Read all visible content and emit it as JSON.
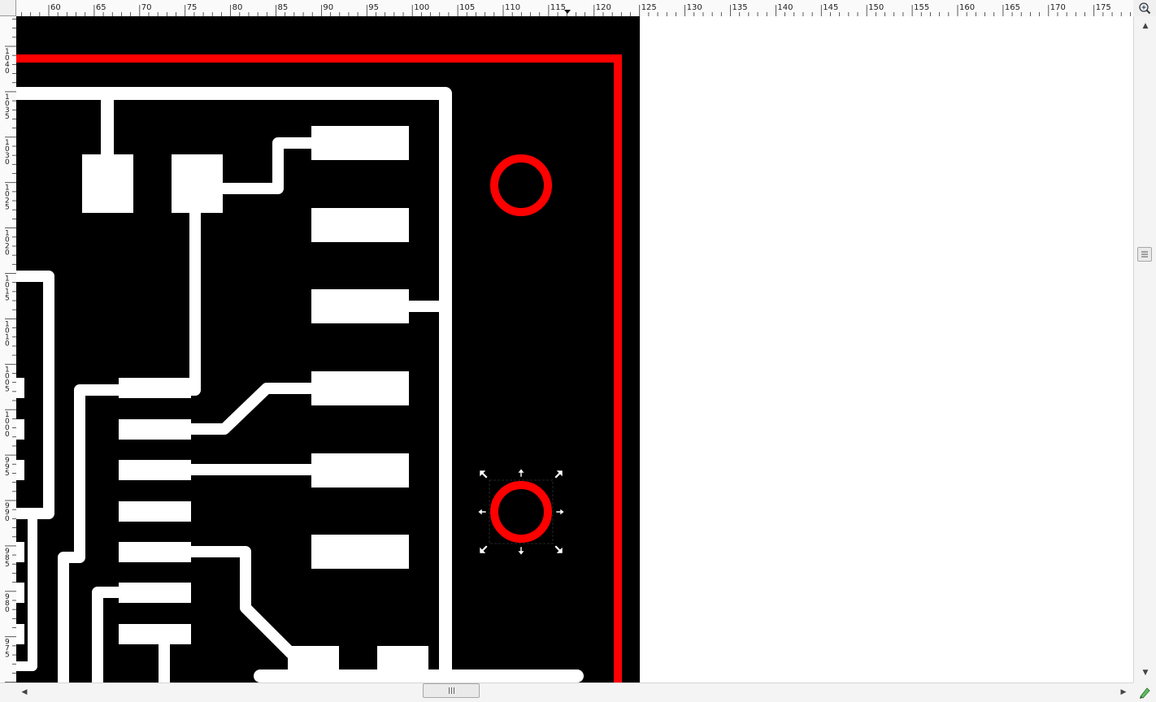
{
  "app": {
    "view": "canvas",
    "zoom_icon": "zoom-fit-icon",
    "status_icon": "pen-pressure-icon"
  },
  "ruler": {
    "horizontal_labels": [
      "60",
      "65",
      "70",
      "75",
      "80",
      "85",
      "90",
      "95",
      "100",
      "105",
      "110",
      "115",
      "120",
      "125",
      "130",
      "135",
      "140",
      "145",
      "150",
      "155",
      "160",
      "165",
      "170",
      "175"
    ],
    "vertical_labels": [
      "1\n0\n4\n0",
      "1\n0\n3\n5",
      "1\n0\n3\n0",
      "1\n0\n2\n5",
      "1\n0\n2\n0",
      "1\n0\n1\n5",
      "1\n0\n1\n0",
      "1\n0\n0\n5",
      "1\n0\n0\n0",
      "9\n9\n5",
      "9\n9\n0",
      "9\n8\n5",
      "9\n8\n0",
      "9\n7\n5"
    ]
  },
  "colors": {
    "board": "#000000",
    "trace": "#ffffff",
    "outline": "#ff0000",
    "ruler_bg": "#fafafa"
  },
  "selection": {
    "object": "mounting-hole-bottom",
    "handles": "scale"
  },
  "scrollbars": {
    "horizontal_thumb_icon": "grip-icon",
    "vertical_thumb_icon": "grip-icon"
  }
}
